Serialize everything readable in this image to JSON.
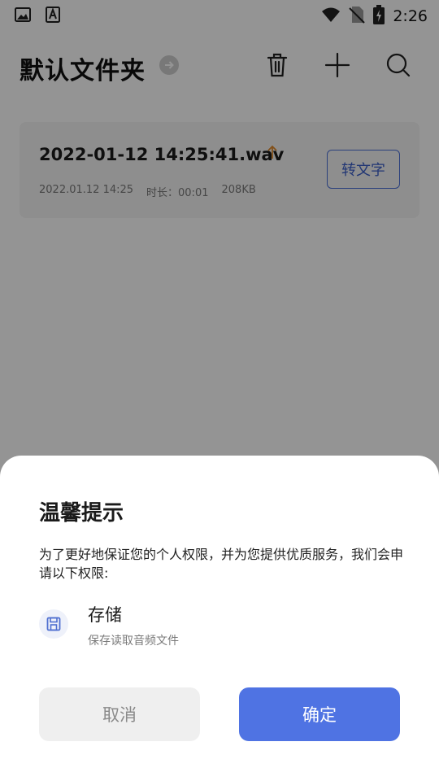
{
  "status_bar": {
    "time": "2:26",
    "icons": [
      "image-icon",
      "font-icon",
      "wifi-icon",
      "no-sim-icon",
      "battery-charging-icon"
    ]
  },
  "header": {
    "title": "默认文件夹",
    "icons": [
      "arrow-right-circle-icon",
      "trash-icon",
      "plus-icon",
      "search-icon"
    ]
  },
  "recording": {
    "file_name": "2022-01-12 14:25:41.wav",
    "date": "2022.01.12 14:25",
    "duration": "时长：00:01",
    "size": "208KB",
    "convert_label": "转文字",
    "upload_color": "#e08a2c"
  },
  "dialog": {
    "title": "温馨提示",
    "description": "为了更好地保证您的个人权限，并为您提供优质服务，我们会申请以下权限:",
    "permission": {
      "name": "存储",
      "description": "保存读取音频文件",
      "icon": "save-icon"
    },
    "cancel_label": "取消",
    "confirm_label": "确定",
    "accent_color": "#4f73e3"
  }
}
